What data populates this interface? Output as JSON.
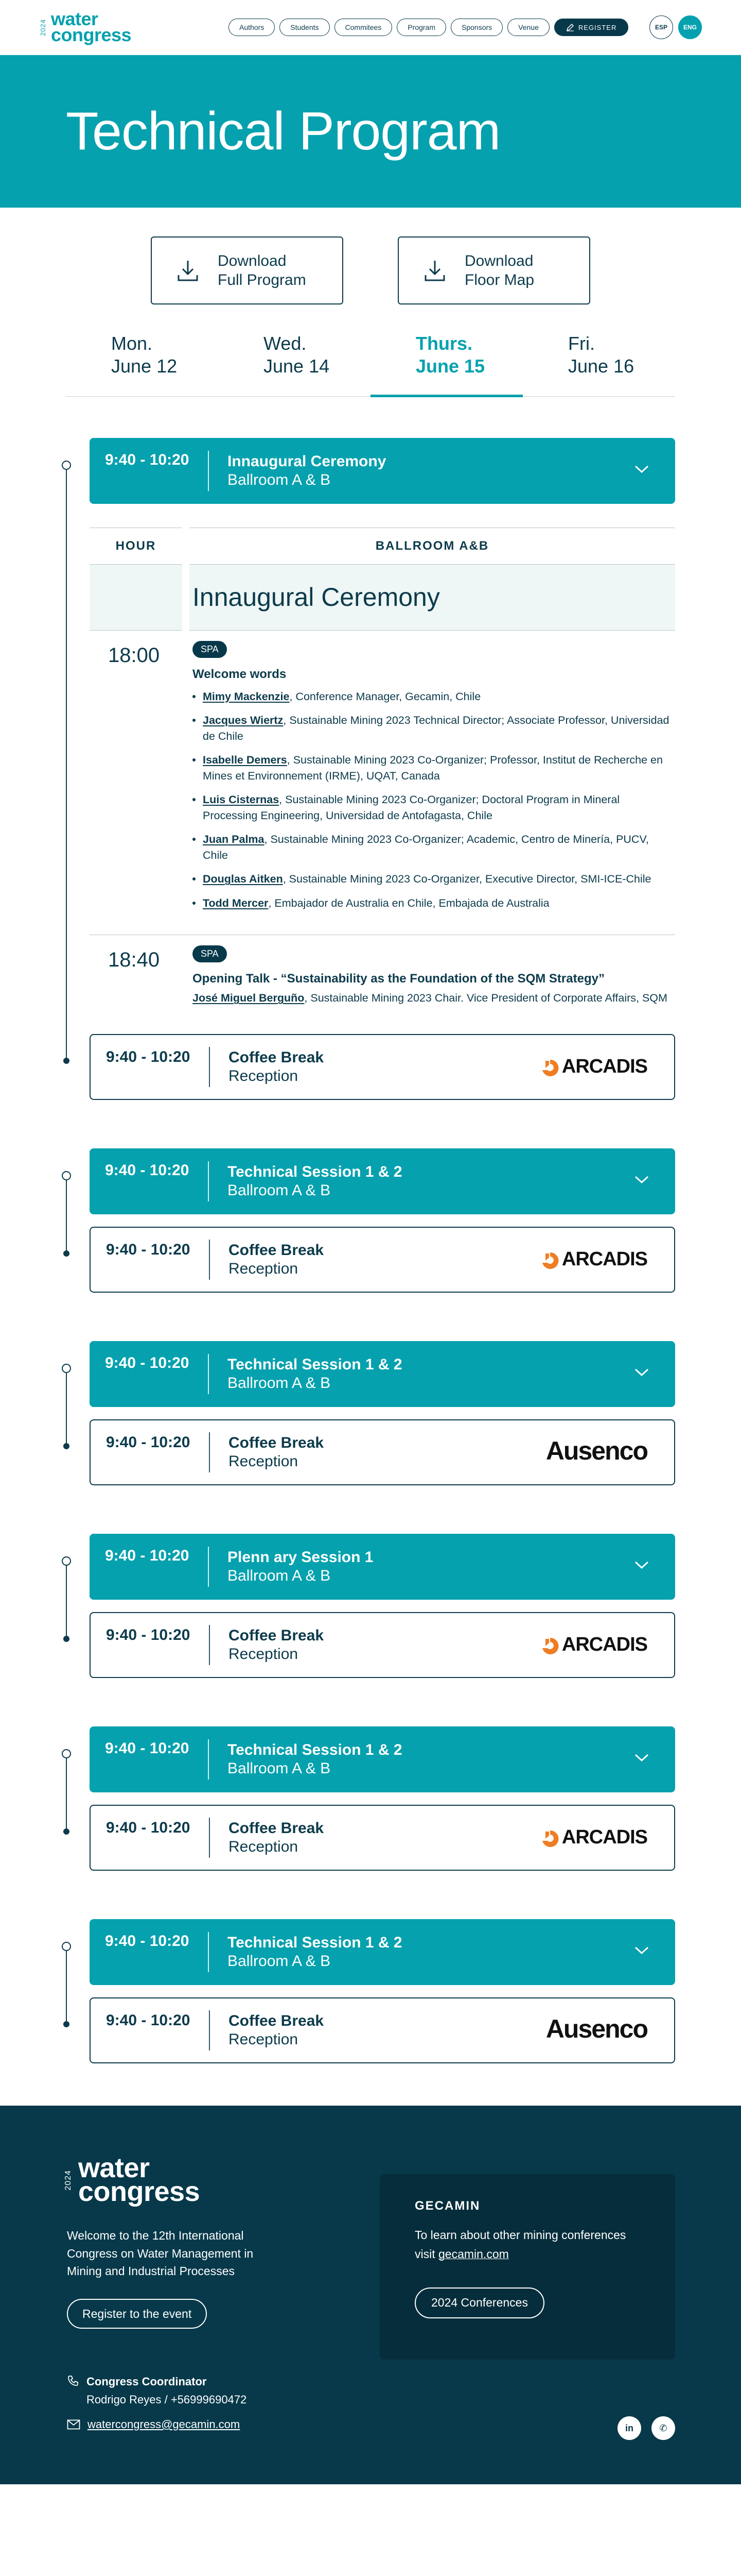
{
  "header": {
    "logo": {
      "year": "2024",
      "line1": "water",
      "line2": "congress"
    },
    "nav": [
      "Authors",
      "Students",
      "Commitees",
      "Program",
      "Sponsors",
      "Venue"
    ],
    "register_label": "REGISTER",
    "languages": [
      "ESP",
      "ENG"
    ],
    "active_language": "ENG"
  },
  "hero": {
    "title": "Technical Program"
  },
  "downloads": [
    {
      "line1": "Download",
      "line2": "Full Program"
    },
    {
      "line1": "Download",
      "line2": "Floor Map"
    }
  ],
  "days": [
    {
      "day": "Mon.",
      "date": "June 12"
    },
    {
      "day": "Wed.",
      "date": "June 14"
    },
    {
      "day": "Thurs.",
      "date": "June 15"
    },
    {
      "day": "Fri.",
      "date": "June 16"
    }
  ],
  "active_day": "Thurs.",
  "colors": {
    "teal": "#05a1ae",
    "navy": "#0d3b4c",
    "footer": "#07394a",
    "arcadis_orange": "#ef7d23"
  },
  "blocks": [
    {
      "session": {
        "time": "9:40 - 10:20",
        "title": "Innaugural Ceremony",
        "room": "Ballroom A & B",
        "expanded": true
      },
      "detail": {
        "hour_header": "HOUR",
        "room_header": "BALLROOM A&B",
        "band_title": "Innaugural Ceremony",
        "rows": [
          {
            "hour": "18:00",
            "badge": "SPA",
            "title": "Welcome words",
            "speakers": [
              {
                "name": "Mimy Mackenzie",
                "info": ", Conference Manager, Gecamin, Chile"
              },
              {
                "name": "Jacques Wiertz",
                "info": ", Sustainable Mining 2023 Technical Director; Associate Professor, Universidad de Chile"
              },
              {
                "name": "Isabelle Demers",
                "info": ", Sustainable Mining 2023 Co-Organizer; Professor, Institut de Recherche en Mines et Environnement (IRME), UQAT, Canada"
              },
              {
                "name": "Luis Cisternas",
                "info": ", Sustainable Mining 2023 Co-Organizer; Doctoral Program in Mineral Processing Engineering, Universidad de Antofagasta, Chile"
              },
              {
                "name": "Juan Palma",
                "info": ", Sustainable Mining 2023 Co-Organizer; Academic, Centro de Minería, PUCV, Chile"
              },
              {
                "name": "Douglas Aitken",
                "info": ", Sustainable Mining 2023 Co-Organizer, Executive Director, SMI-ICE-Chile"
              },
              {
                "name": "Todd Mercer",
                "info": ", Embajador de Australia en Chile, Embajada de Australia"
              }
            ]
          },
          {
            "hour": "18:40",
            "badge": "SPA",
            "title": "Opening Talk - “Sustainability as the Foundation of the SQM Strategy”",
            "speaker_name": "José Miguel Berguño",
            "speaker_info": ", Sustainable Mining 2023 Chair. Vice President of Corporate Affairs, SQM"
          }
        ]
      },
      "coffee": {
        "time": "9:40 - 10:20",
        "title": "Coffee Break",
        "room": "Reception",
        "sponsor": "ARCADIS"
      }
    },
    {
      "session": {
        "time": "9:40 - 10:20",
        "title": "Technical Session 1 & 2",
        "room": "Ballroom A & B",
        "expanded": false
      },
      "coffee": {
        "time": "9:40 - 10:20",
        "title": "Coffee Break",
        "room": "Reception",
        "sponsor": "ARCADIS"
      }
    },
    {
      "session": {
        "time": "9:40 - 10:20",
        "title": "Technical Session 1 & 2",
        "room": "Ballroom A & B",
        "expanded": false
      },
      "coffee": {
        "time": "9:40 - 10:20",
        "title": "Coffee Break",
        "room": "Reception",
        "sponsor": "Ausenco"
      }
    },
    {
      "session": {
        "time": "9:40 - 10:20",
        "title": "Plenn ary Session 1",
        "room": "Ballroom A & B",
        "expanded": false
      },
      "coffee": {
        "time": "9:40 - 10:20",
        "title": "Coffee Break",
        "room": "Reception",
        "sponsor": "ARCADIS"
      }
    },
    {
      "session": {
        "time": "9:40 - 10:20",
        "title": "Technical Session 1 & 2",
        "room": "Ballroom A & B",
        "expanded": false
      },
      "coffee": {
        "time": "9:40 - 10:20",
        "title": "Coffee Break",
        "room": "Reception",
        "sponsor": "ARCADIS"
      }
    },
    {
      "session": {
        "time": "9:40 - 10:20",
        "title": "Technical Session 1 & 2",
        "room": "Ballroom A & B",
        "expanded": false
      },
      "coffee": {
        "time": "9:40 - 10:20",
        "title": "Coffee Break",
        "room": "Reception",
        "sponsor": "Ausenco"
      }
    }
  ],
  "footer": {
    "logo": {
      "year": "2024",
      "line1": "water",
      "line2": "congress"
    },
    "description": "Welcome to the 12th International Congress on Water Management in Mining and Industrial Processes",
    "register_button": "Register to the event",
    "card": {
      "title": "GECAMIN",
      "text_prefix": "To learn about other mining conferences visit ",
      "link": "gecamin.com",
      "button": "2024 Conferences"
    },
    "contact_title": "Congress Coordinator",
    "contact_detail": "Rodrigo Reyes / +56999690472",
    "email": "watercongress@gecamin.com",
    "social": [
      {
        "icon": "linkedin-icon",
        "label": "in"
      },
      {
        "icon": "whatsapp-icon",
        "label": "✆"
      }
    ]
  }
}
